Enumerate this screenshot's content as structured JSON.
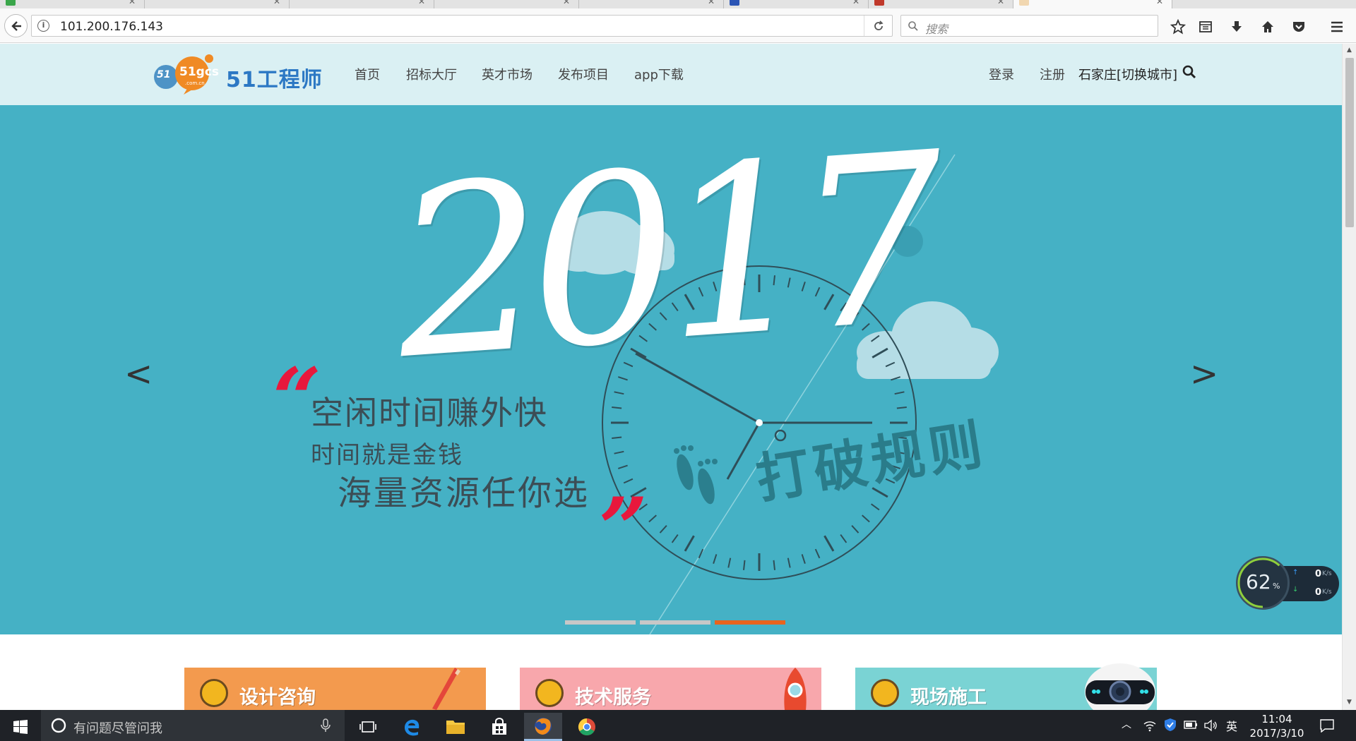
{
  "browser": {
    "url": "101.200.176.143",
    "search_placeholder": "搜索"
  },
  "site": {
    "logo_text": "51工程师",
    "logo_badge": "51gcs",
    "logo_domain": ".com.cn",
    "nav": [
      "首页",
      "招标大厅",
      "英才市场",
      "发布项目",
      "app下载"
    ],
    "login": "登录",
    "register": "注册",
    "city": "石家庄[切换城市]"
  },
  "hero": {
    "year": "2017",
    "open_quote": "“",
    "close_quote": "”",
    "line1": "空闲时间赚外快",
    "line2": "时间就是金钱",
    "line3": "海量资源任你选",
    "slogan": "打破规则",
    "prev": "<",
    "next": ">",
    "slides_total": 3,
    "active_slide": 3
  },
  "cards": [
    {
      "title": "设计咨询",
      "color": "#f39a4e"
    },
    {
      "title": "技术服务",
      "color": "#f8a7ac"
    },
    {
      "title": "现场施工",
      "color": "#7ad3d4"
    }
  ],
  "widget": {
    "percent": "62",
    "percent_unit": "%",
    "up": "0",
    "down": "0",
    "unit": "K/s"
  },
  "taskbar": {
    "search_placeholder": "有问题尽管问我",
    "ime": "英",
    "time": "11:04",
    "date": "2017/3/10"
  }
}
